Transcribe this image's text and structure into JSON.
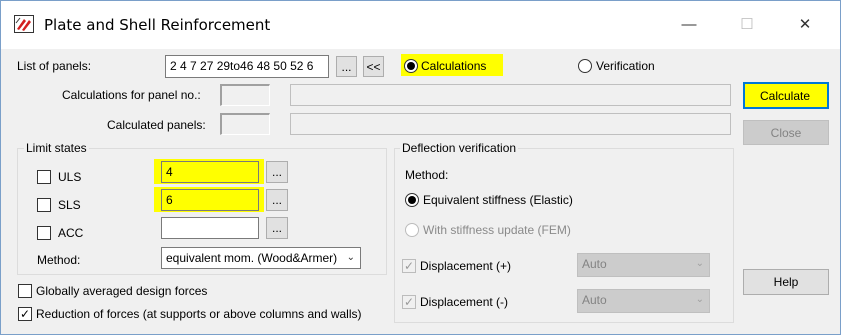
{
  "window": {
    "title": "Plate and Shell Reinforcement",
    "controls": {
      "minimize": "—",
      "maximize": "☐",
      "close": "✕"
    }
  },
  "panels": {
    "list_label": "List of panels:",
    "list_value": "2 4 7 27 29to46 48 50 52 6",
    "browse_btn": "...",
    "collapse_btn": "<<",
    "calc_for_label": "Calculations for panel no.:",
    "calculated_label": "Calculated panels:"
  },
  "mode": {
    "calculations": "Calculations",
    "verification": "Verification",
    "selected": "calculations"
  },
  "buttons": {
    "calculate": "Calculate",
    "close": "Close",
    "help": "Help"
  },
  "limit_states": {
    "title": "Limit states",
    "uls_label": "ULS",
    "uls_value": "4",
    "sls_label": "SLS",
    "sls_value": "6",
    "acc_label": "ACC",
    "acc_value": "",
    "browse_btn": "...",
    "method_label": "Method:",
    "method_value": "equivalent mom. (Wood&Armer)"
  },
  "options": {
    "global_avg": "Globally averaged design forces",
    "reduction": "Reduction of forces (at supports or above columns and walls)"
  },
  "deflection": {
    "title": "Deflection verification",
    "method_label": "Method:",
    "equivalent": "Equivalent stiffness (Elastic)",
    "with_update": "With stiffness update (FEM)",
    "disp_plus": "Displacement (+)",
    "disp_minus": "Displacement (-)",
    "auto_plus": "Auto",
    "auto_minus": "Auto"
  },
  "colors": {
    "highlight": "#ffff00",
    "accent_border": "#0078d7"
  }
}
